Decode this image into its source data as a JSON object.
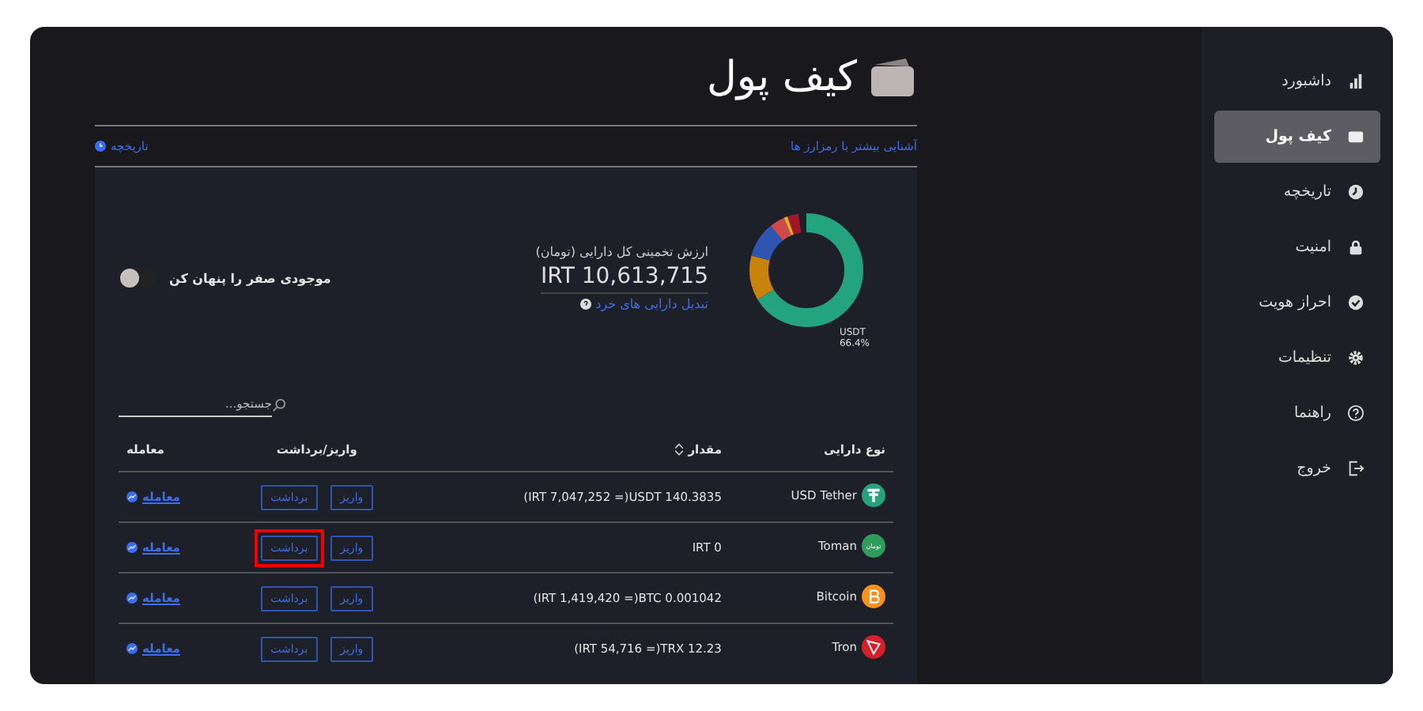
{
  "sidebar": {
    "items": [
      {
        "kind": "chart",
        "label": "داشبورد",
        "selected": false
      },
      {
        "kind": "wallet",
        "label": "کیف پول",
        "selected": true
      },
      {
        "kind": "clock",
        "label": "تاریخچه",
        "selected": false
      },
      {
        "kind": "lock",
        "label": "امنیت",
        "selected": false
      },
      {
        "kind": "check",
        "label": "احراز هویت",
        "selected": false
      },
      {
        "kind": "gear",
        "label": "تنظیمات",
        "selected": false
      },
      {
        "kind": "help",
        "label": "راهنما",
        "selected": false
      },
      {
        "kind": "exit",
        "label": "خروج",
        "selected": false
      }
    ]
  },
  "page": {
    "title": "کیف پول",
    "learn_link": "آشنایی بیشتر با رمزارز ها",
    "history_link": "تاریخچه"
  },
  "summary": {
    "donut_label": "USDT",
    "donut_percent": "66.4%",
    "total_label": "ارزش تخمینی کل دارایی (تومان)",
    "total_value": "IRT 10,613,715",
    "convert_link": "تبدیل دارایی های خرد"
  },
  "hide_zero": {
    "label": "موجودی صفر را پنهان کن",
    "on": false
  },
  "search": {
    "placeholder": "جستجو..."
  },
  "table": {
    "columns": [
      "نوع دارایی",
      "مقدار",
      "واریز/برداشت",
      "معامله"
    ],
    "rows": [
      {
        "kind": "tether",
        "name": "USD Tether",
        "amount": "(IRT 7,047,252 =)USDT 140.3835",
        "deposit": "واریز",
        "withdraw": "برداشت",
        "trade": "معامله",
        "highlighted": false
      },
      {
        "kind": "toman",
        "coin_text": "تومان",
        "name": "Toman",
        "amount": "IRT 0",
        "deposit": "واریز",
        "withdraw": "برداشت",
        "trade": "معامله",
        "highlighted": true
      },
      {
        "kind": "bitcoin",
        "name": "Bitcoin",
        "amount": "(IRT 1,419,420 =)BTC 0.001042",
        "deposit": "واریز",
        "withdraw": "برداشت",
        "trade": "معامله",
        "highlighted": false
      },
      {
        "kind": "tron",
        "name": "Tron",
        "amount": "(IRT 54,716 =)TRX 12.23",
        "deposit": "واریز",
        "withdraw": "برداشت",
        "trade": "معامله",
        "highlighted": false
      }
    ]
  }
}
